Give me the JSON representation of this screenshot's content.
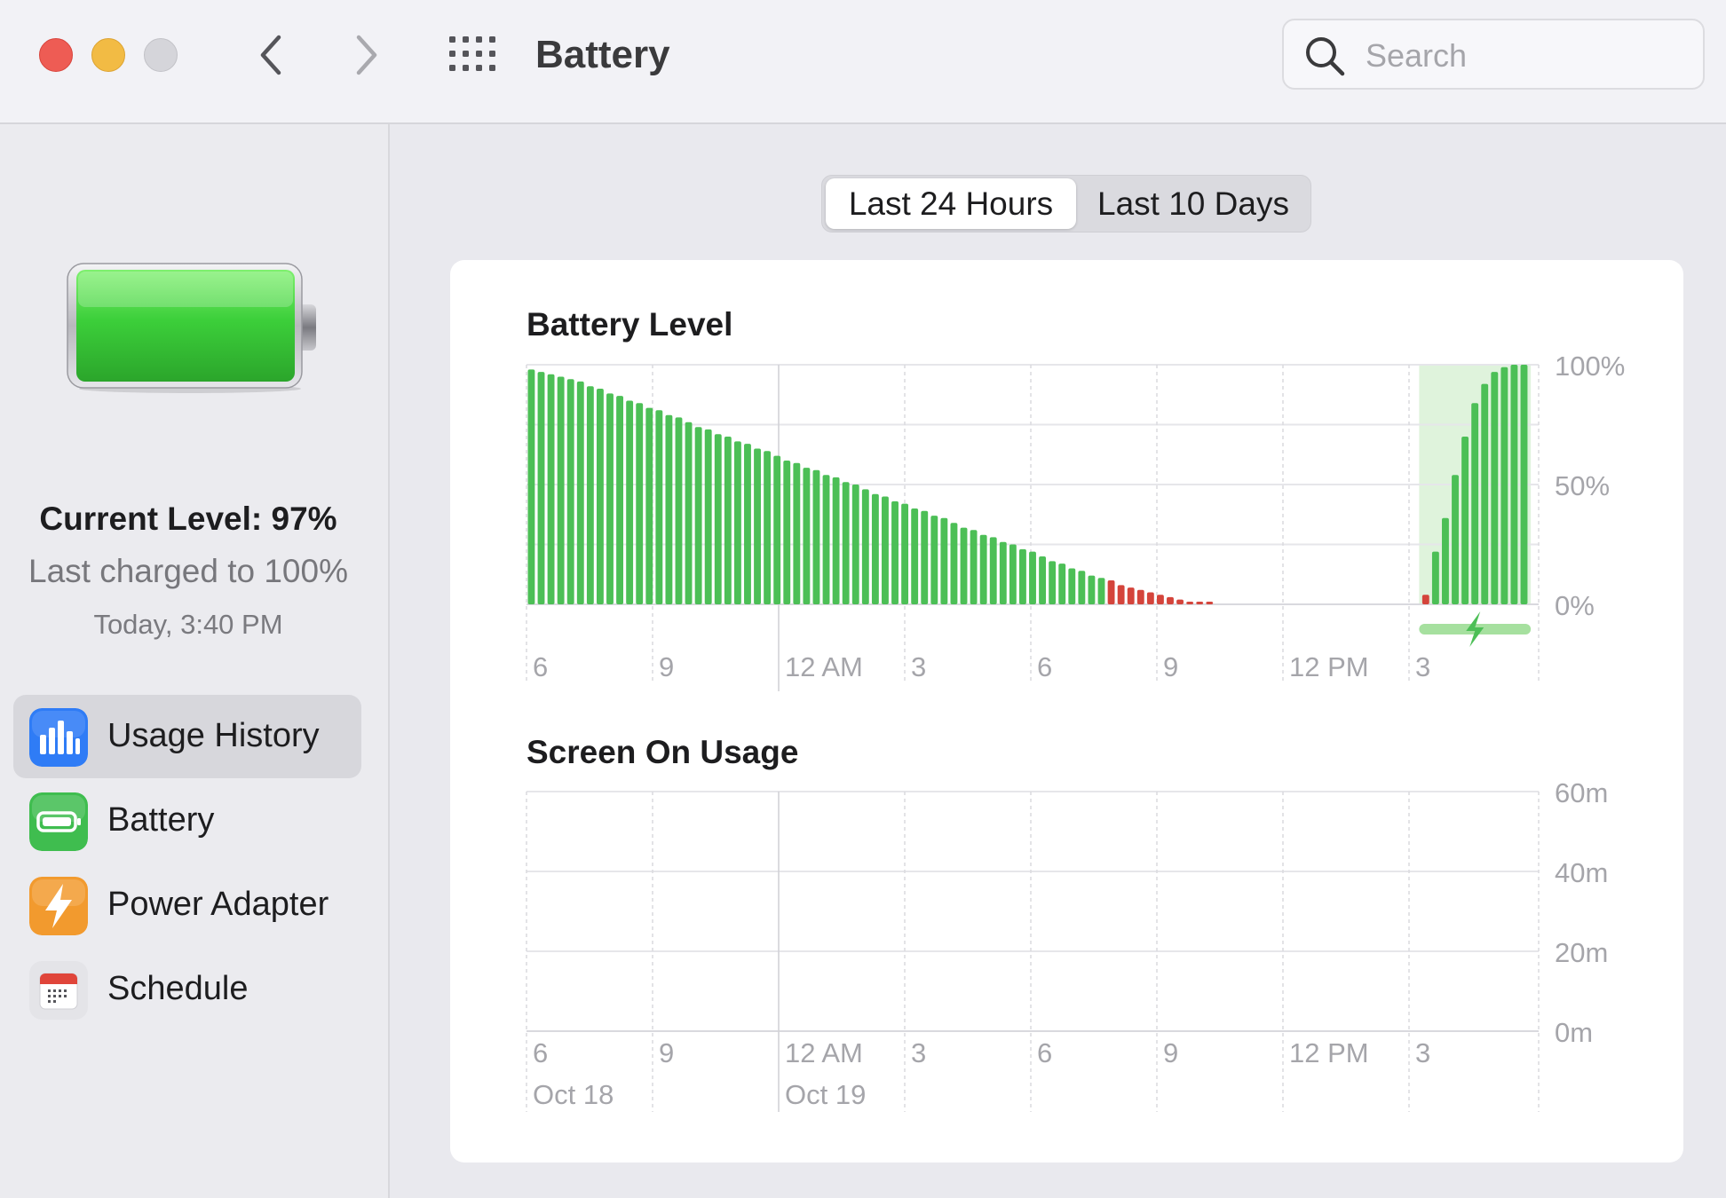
{
  "window": {
    "title": "Battery"
  },
  "search": {
    "placeholder": "Search"
  },
  "sidebar": {
    "current_level": "Current Level: 97%",
    "last_charged": "Last charged to 100%",
    "charged_time": "Today, 3:40 PM",
    "items": [
      {
        "label": "Usage History",
        "icon": "bar-chart-icon",
        "selected": true,
        "color": "#2f7cf6"
      },
      {
        "label": "Battery",
        "icon": "battery-icon",
        "selected": false,
        "color": "#3fbd4f"
      },
      {
        "label": "Power Adapter",
        "icon": "lightning-icon",
        "selected": false,
        "color": "#f29a2e"
      },
      {
        "label": "Schedule",
        "icon": "calendar-icon",
        "selected": false,
        "color": "#e0453a"
      }
    ]
  },
  "tabs": [
    {
      "label": "Last 24 Hours",
      "active": true
    },
    {
      "label": "Last 10 Days",
      "active": false
    }
  ],
  "colors": {
    "bar_normal": "#4cbf56",
    "bar_low": "#d4443b",
    "charging_band": "#dff3dc",
    "charging_bar": "#a6e09f"
  },
  "chart_data": [
    {
      "type": "bar",
      "title": "Battery Level",
      "x_ticks": [
        "6",
        "9",
        "12 AM",
        "3",
        "6",
        "9",
        "12 PM",
        "3"
      ],
      "y_ticks": [
        "100%",
        "50%",
        "0%"
      ],
      "ylim": [
        0,
        100
      ],
      "low_threshold": 10,
      "values": [
        98,
        97,
        96,
        95,
        94,
        93,
        91,
        90,
        88,
        87,
        85,
        84,
        82,
        81,
        79,
        78,
        76,
        74,
        73,
        71,
        70,
        68,
        67,
        65,
        64,
        62,
        60,
        59,
        57,
        56,
        54,
        53,
        51,
        50,
        48,
        46,
        45,
        43,
        42,
        40,
        39,
        37,
        36,
        34,
        32,
        31,
        29,
        28,
        26,
        25,
        23,
        22,
        20,
        18,
        17,
        15,
        14,
        12,
        11,
        10,
        8,
        7,
        6,
        5,
        4,
        3,
        2,
        1,
        1,
        1,
        0,
        0,
        0,
        0,
        0,
        0,
        0,
        0,
        0,
        0,
        0,
        0,
        0,
        0,
        0,
        0,
        0,
        0,
        0,
        0,
        0,
        4,
        22,
        36,
        54,
        70,
        84,
        92,
        97,
        99,
        100,
        100
      ],
      "charging_start_index": 91,
      "charging_end_index": 101
    },
    {
      "type": "bar",
      "title": "Screen On Usage",
      "x_ticks": [
        "6",
        "9",
        "12 AM",
        "3",
        "6",
        "9",
        "12 PM",
        "3"
      ],
      "date_labels": [
        "Oct 18",
        "Oct 19"
      ],
      "y_ticks": [
        "60m",
        "40m",
        "20m",
        "0m"
      ],
      "ylim": [
        0,
        60
      ],
      "values": []
    }
  ]
}
